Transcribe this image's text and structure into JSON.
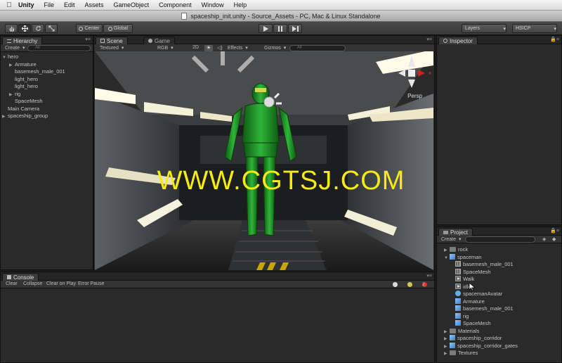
{
  "menubar": {
    "app": "Unity",
    "items": [
      "File",
      "Edit",
      "Assets",
      "GameObject",
      "Component",
      "Window",
      "Help"
    ]
  },
  "window_title": "spaceship_init.unity - Source_Assets - PC, Mac & Linux Standalone",
  "toolbar": {
    "pivot": "Center",
    "space": "Global",
    "layers": "Layers",
    "layout": "HSICP"
  },
  "hierarchy": {
    "tab": "Hierarchy",
    "create": "Create",
    "search": "All",
    "items": [
      "hero",
      "Armature",
      "basemesh_male_001",
      "light_hero",
      "light_hero",
      "rig",
      "SpaceMesh",
      "Main Camera",
      "spaceship_group"
    ]
  },
  "scene": {
    "tab_scene": "Scene",
    "tab_game": "Game",
    "shading": "Textured",
    "render": "RGB",
    "mode_2d": "2D",
    "effects": "Effects",
    "gizmos": "Gizmos",
    "search": "All",
    "persp": "Persp",
    "axis_x": "x",
    "watermark": "WWW.CGTSJ.COM"
  },
  "inspector": {
    "tab": "Inspector"
  },
  "console": {
    "tab": "Console",
    "clear": "Clear",
    "collapse": "Collapse",
    "clear_on_play": "Clear on Play",
    "error_pause": "Error Pause",
    "info_count": "0",
    "warn_count": "0",
    "error_count": "2"
  },
  "project": {
    "tab": "Project",
    "create": "Create",
    "items": [
      "rock",
      "spaceman",
      "basemesh_male_001",
      "SpaceMesh",
      "Walk",
      "idle",
      "spacemanAvatar",
      "Armature",
      "basemesh_male_001",
      "rig",
      "SpaceMesh",
      "Materials",
      "spaceship_corridor",
      "spaceship_corridor_gates",
      "Textures"
    ]
  },
  "colors": {
    "selection": "#3d5a80",
    "watermark": "#f4ec11",
    "character": "#1f8a1f"
  }
}
